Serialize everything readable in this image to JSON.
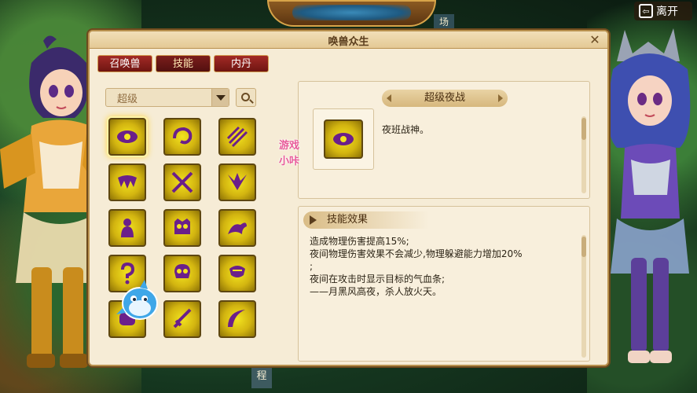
{
  "window": {
    "title": "唤兽众生",
    "close_glyph": "✕",
    "leave_label": "离开",
    "top_tag": "场",
    "bottom_tag": "程"
  },
  "tabs": [
    {
      "label": "召唤兽",
      "active": false
    },
    {
      "label": "技能",
      "active": true
    },
    {
      "label": "内丹",
      "active": false
    }
  ],
  "filter": {
    "value": "超级"
  },
  "skills": [
    {
      "icon": "eye-icon",
      "selected": true
    },
    {
      "icon": "swirl-icon",
      "selected": false
    },
    {
      "icon": "claw-slash-icon",
      "selected": false
    },
    {
      "icon": "fang-mouth-icon",
      "selected": false
    },
    {
      "icon": "crossed-swords-icon",
      "selected": false
    },
    {
      "icon": "wings-icon",
      "selected": false
    },
    {
      "icon": "figure-icon",
      "selected": false
    },
    {
      "icon": "owl-icon",
      "selected": false
    },
    {
      "icon": "dragon-icon",
      "selected": false
    },
    {
      "icon": "question-mark-icon",
      "selected": false
    },
    {
      "icon": "skull-icon",
      "selected": false
    },
    {
      "icon": "serpent-icon",
      "selected": false
    },
    {
      "icon": "fist-icon",
      "selected": false
    },
    {
      "icon": "sword-icon",
      "selected": false
    },
    {
      "icon": "crescent-icon",
      "selected": false
    }
  ],
  "detail": {
    "name": "超级夜战",
    "short_desc": "夜班战神。"
  },
  "effect": {
    "header": "技能效果",
    "lines": [
      "造成物理伤害提高15%;",
      "夜间物理伤害效果不会减少,物理躲避能力增加20%",
      ";",
      "夜间在攻击时显示目标的气血条;",
      "——月黑风高夜，杀人放火天。"
    ]
  },
  "watermark": {
    "line1": "游戏",
    "line2": "小咔"
  },
  "colors": {
    "accent_red": "#a32a26",
    "panel_bg": "#f6ecd6",
    "skill_icon_yellow": "#f3e41f"
  }
}
